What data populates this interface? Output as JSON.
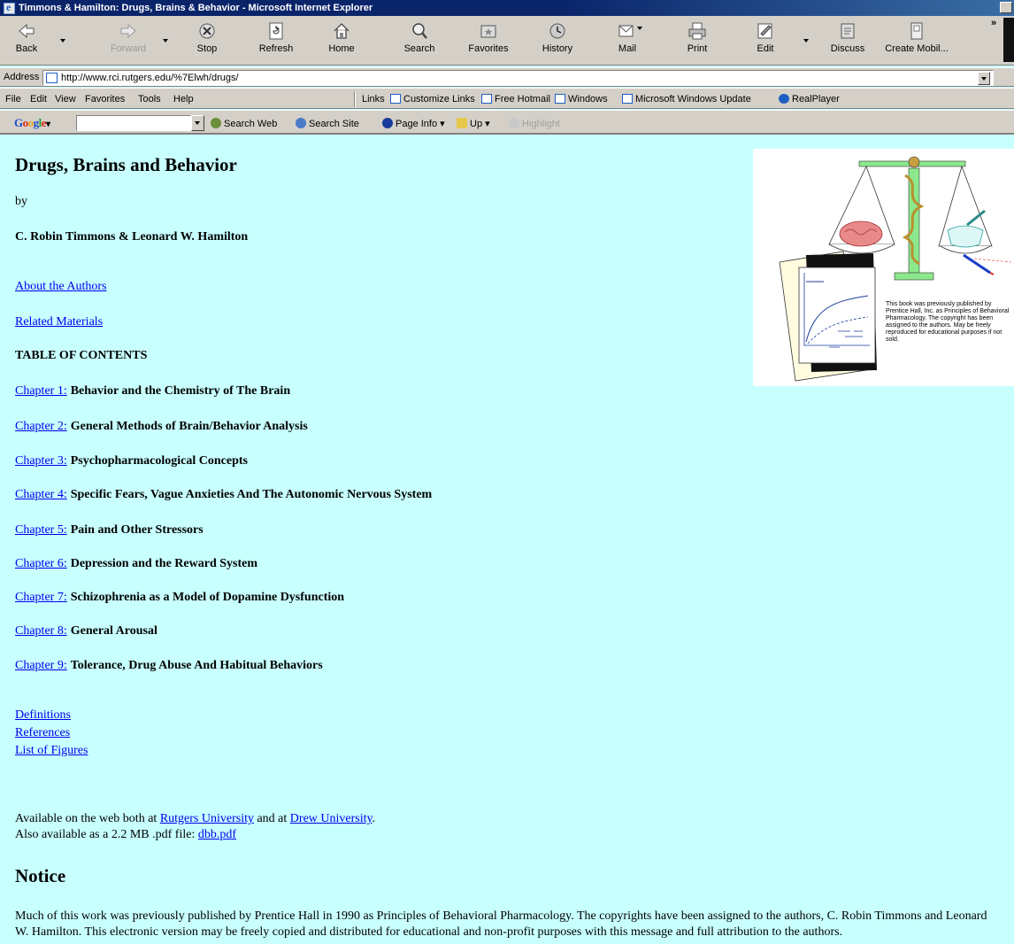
{
  "window": {
    "title": "Timmons & Hamilton: Drugs, Brains & Behavior - Microsoft Internet Explorer"
  },
  "toolbar": {
    "buttons": [
      {
        "label": "Back",
        "icon": "back-arrow-icon"
      },
      {
        "label": "Forward",
        "icon": "forward-arrow-icon"
      },
      {
        "label": "Stop",
        "icon": "stop-icon"
      },
      {
        "label": "Refresh",
        "icon": "refresh-icon"
      },
      {
        "label": "Home",
        "icon": "home-icon"
      },
      {
        "label": "Search",
        "icon": "search-icon"
      },
      {
        "label": "Favorites",
        "icon": "favorites-icon"
      },
      {
        "label": "History",
        "icon": "history-icon"
      },
      {
        "label": "Mail",
        "icon": "mail-icon"
      },
      {
        "label": "Print",
        "icon": "print-icon"
      },
      {
        "label": "Edit",
        "icon": "edit-icon"
      },
      {
        "label": "Discuss",
        "icon": "discuss-icon"
      },
      {
        "label": "Create Mobil...",
        "icon": "create-mobile-icon"
      }
    ],
    "overflow": "»"
  },
  "address": {
    "label": "Address",
    "url": "http://www.rci.rutgers.edu/%7Elwh/drugs/"
  },
  "menu": {
    "items": [
      "File",
      "Edit",
      "View",
      "Favorites",
      "Tools",
      "Help"
    ],
    "links_label": "Links",
    "links": [
      "Customize Links",
      "Free Hotmail",
      "Windows",
      "Microsoft Windows Update",
      "RealPlayer"
    ]
  },
  "google": {
    "logo": "Google",
    "search_web": "Search Web",
    "search_site": "Search Site",
    "page_info": "Page Info",
    "up": "Up",
    "highlight": "Highlight"
  },
  "page": {
    "title": "Drugs, Brains and Behavior",
    "by": "by",
    "authors": "C. Robin Timmons & Leonard W. Hamilton",
    "about_link": "About the Authors",
    "related_link": "Related Materials",
    "toc_heading": "TABLE OF CONTENTS",
    "chapters": [
      {
        "link": "Chapter 1:",
        "title": "Behavior and the Chemistry of The Brain"
      },
      {
        "link": "Chapter 2:",
        "title": "General Methods of Brain/Behavior Analysis"
      },
      {
        "link": "Chapter 3:",
        "title": "Psychopharmacological Concepts"
      },
      {
        "link": "Chapter 4:",
        "title": "Specific Fears, Vague Anxieties And The Autonomic Nervous System"
      },
      {
        "link": "Chapter 5:",
        "title": "Pain and Other Stressors"
      },
      {
        "link": "Chapter 6:",
        "title": "Depression and the Reward System"
      },
      {
        "link": "Chapter 7:",
        "title": "Schizophrenia as a Model of Dopamine Dysfunction"
      },
      {
        "link": "Chapter 8:",
        "title": "General Arousal"
      },
      {
        "link": "Chapter 9:",
        "title": "Tolerance, Drug Abuse And Habitual Behaviors"
      }
    ],
    "extra_links": [
      "Definitions",
      "References",
      "List of Figures"
    ],
    "available_prefix": "Available on the web both at ",
    "rutgers_link": "Rutgers University",
    "available_mid": " and at ",
    "drew_link": "Drew University",
    "available_suffix": ".",
    "pdf_prefix": "Also available as a 2.2 MB .pdf file: ",
    "pdf_link": "dbb.pdf",
    "notice_heading": "Notice",
    "notice_text": "Much of this work was previously published by Prentice Hall in 1990 as Principles of Behavioral Pharmacology. The copyrights have been assigned to the authors, C. Robin Timmons and Leonard W. Hamilton. This electronic version may be freely copied and distributed for educational and non-profit purposes with this message and full attribution to the authors."
  },
  "cover": {
    "caption": "This book was previously published by Prentice Hall, Inc. as Principles of Behavioral Pharmacology. The copyright has been assigned to the authors. May be freely reproduced for educational purposes if not sold."
  },
  "colors": {
    "page_background": "#c8ffff",
    "link": "#0000ee",
    "title_bar": "#0a246a",
    "chrome": "#d4d0c8"
  }
}
